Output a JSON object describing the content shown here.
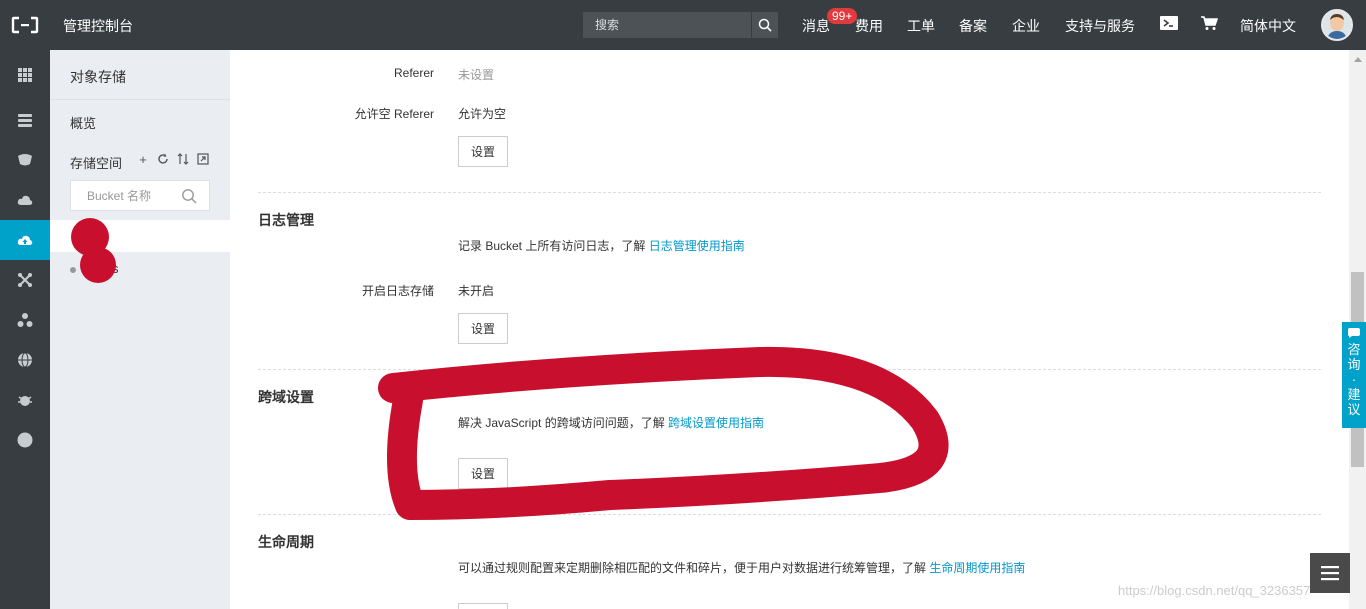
{
  "topbar": {
    "title": "管理控制台",
    "search_placeholder": "搜索",
    "nav": {
      "messages": "消息",
      "messages_badge": "99+",
      "billing": "费用",
      "tickets": "工单",
      "icp": "备案",
      "enterprise": "企业",
      "support": "支持与服务",
      "language": "简体中文"
    },
    "icons": [
      "terminal-icon",
      "cart-icon"
    ]
  },
  "rail": {
    "active_index": 5,
    "accent_color": "#00a2ca"
  },
  "sidebar": {
    "title": "对象存储",
    "overview": "概览",
    "buckets_label": "存储空间",
    "bucket_search_placeholder": "Bucket 名称",
    "bucket_row2_suffix": "s"
  },
  "main": {
    "referer": {
      "label": "Referer",
      "value": "未设置",
      "allow_empty_label": "允许空 Referer",
      "allow_empty_value": "允许为空",
      "button": "设置"
    },
    "logging": {
      "title": "日志管理",
      "desc": "记录 Bucket 上所有访问日志，了解 ",
      "link": "日志管理使用指南",
      "field_label": "开启日志存储",
      "field_value": "未开启",
      "button": "设置"
    },
    "cors": {
      "title": "跨域设置",
      "desc": "解决 JavaScript 的跨域访问问题，了解 ",
      "link": "跨域设置使用指南",
      "button": "设置"
    },
    "lifecycle": {
      "title": "生命周期",
      "desc": "可以通过规则配置来定期删除相匹配的文件和碎片，便于用户对数据进行统筹管理，了解 ",
      "link": "生命周期使用指南"
    }
  },
  "feedback": {
    "chars": [
      "咨",
      "询",
      "·",
      "建",
      "议"
    ]
  },
  "watermark": "https://blog.csdn.net/qq_3236357"
}
